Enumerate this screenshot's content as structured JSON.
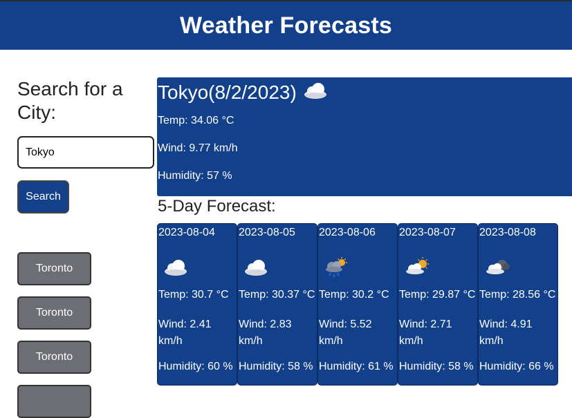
{
  "header": {
    "title": "Weather Forecasts"
  },
  "search": {
    "title": "Search for a City:",
    "input_value": "Tokyo",
    "button_label": "Search"
  },
  "history": [
    {
      "label": "Toronto"
    },
    {
      "label": "Toronto"
    },
    {
      "label": "Toronto"
    },
    {
      "label": ""
    }
  ],
  "current": {
    "title": "Tokyo(8/2/2023)",
    "icon": "cloud-icon",
    "temp": "Temp: 34.06 °C",
    "wind": "Wind: 9.77 km/h",
    "humidity": "Humidity: 57 %"
  },
  "forecast": {
    "title": "5-Day Forecast:",
    "days": [
      {
        "date": "2023-08-04",
        "icon": "cloud-icon",
        "temp": "Temp: 30.7 °C",
        "wind": "Wind: 2.41 km/h",
        "humidity": "Humidity: 60 %"
      },
      {
        "date": "2023-08-05",
        "icon": "cloud-icon",
        "temp": "Temp: 30.37 °C",
        "wind": "Wind: 2.83 km/h",
        "humidity": "Humidity: 58 %"
      },
      {
        "date": "2023-08-06",
        "icon": "rain-sun-icon",
        "temp": "Temp: 30.2 °C",
        "wind": "Wind: 5.52 km/h",
        "humidity": "Humidity: 61 %"
      },
      {
        "date": "2023-08-07",
        "icon": "partly-sunny-icon",
        "temp": "Temp: 29.87 °C",
        "wind": "Wind: 2.71 km/h",
        "humidity": "Humidity: 58 %"
      },
      {
        "date": "2023-08-08",
        "icon": "dark-cloud-icon",
        "temp": "Temp: 28.56 °C",
        "wind": "Wind: 4.91 km/h",
        "humidity": "Humidity: 66 %"
      }
    ]
  },
  "colors": {
    "primary": "#13408a",
    "history_button": "#6c6e73"
  }
}
